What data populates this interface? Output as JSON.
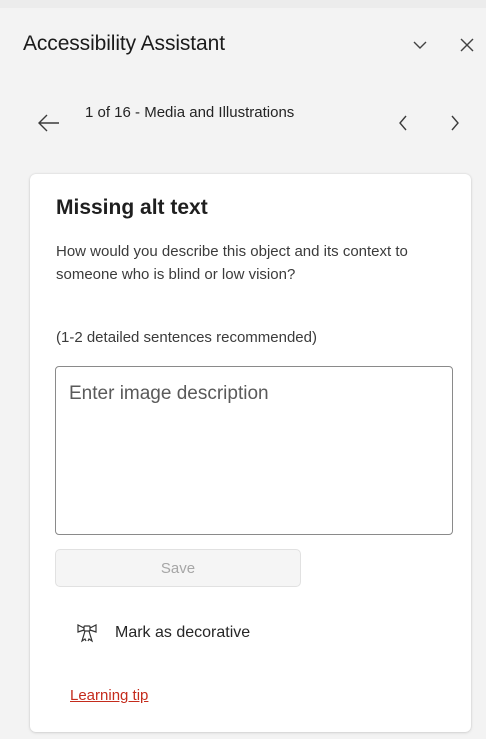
{
  "pane": {
    "title": "Accessibility Assistant",
    "collapse_icon": "chevron-down-icon",
    "close_icon": "close-icon"
  },
  "nav": {
    "back_icon": "arrow-left-icon",
    "position_text": "1 of 16 - Media and Illustrations",
    "prev_icon": "chevron-left-icon",
    "next_icon": "chevron-right-icon"
  },
  "card": {
    "title": "Missing alt text",
    "description": "How would you describe this object and its context to someone who is blind or low vision?",
    "hint": "(1-2 detailed sentences recommended)",
    "input_value": "",
    "input_placeholder": "Enter image description",
    "save_label": "Save",
    "save_enabled": false,
    "decorative_label": "Mark as decorative",
    "decorative_icon": "ribbon-icon",
    "tip_label": "Learning tip",
    "tip_color": "#c42b1c"
  }
}
